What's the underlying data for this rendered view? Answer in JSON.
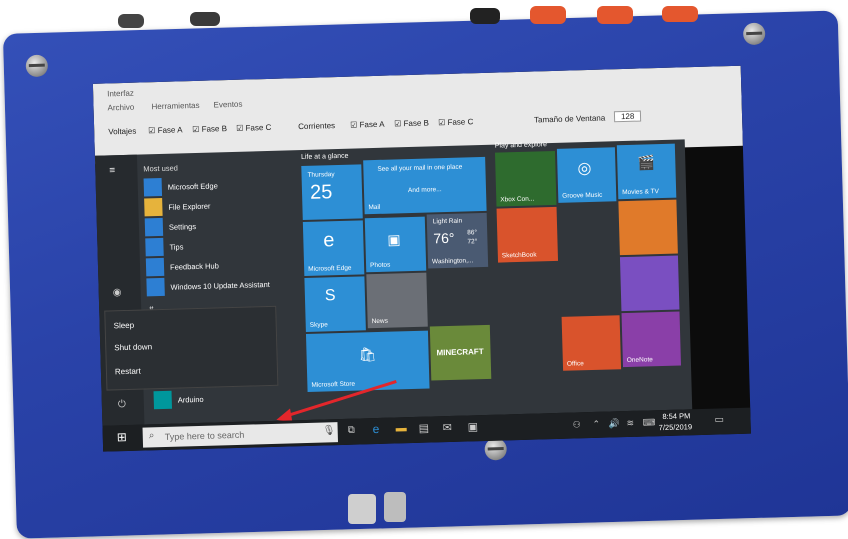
{
  "app": {
    "title": "Interfaz",
    "menus": [
      "Archivo",
      "Herramientas",
      "Eventos"
    ],
    "voltajes_label": "Voltajes",
    "corrientes_label": "Corrientes",
    "phases": [
      "Fase A",
      "Fase B",
      "Fase C"
    ],
    "window_size_label": "Tamaño de Ventana",
    "window_size_value": "128"
  },
  "start_menu": {
    "most_used_label": "Most used",
    "most_used": [
      "Microsoft Edge",
      "File Explorer",
      "Settings",
      "Tips",
      "Feedback Hub",
      "Windows 10 Update Assistant"
    ],
    "section_hash": "#",
    "power_options": [
      "Sleep",
      "Shut down",
      "Restart"
    ],
    "arduino_label": "Arduino"
  },
  "tiles": {
    "life_header": "Life at a glance",
    "play_header": "Play and explore",
    "calendar_day": "Thursday",
    "calendar_date": "25",
    "mail_text": "See all your mail in one place",
    "mail_more": "And more...",
    "mail_label": "Mail",
    "edge_label": "Microsoft Edge",
    "photos_label": "Photos",
    "weather_cond": "Light Rain",
    "weather_temp": "76°",
    "weather_hi": "86°",
    "weather_lo": "72°",
    "weather_city": "Washington,...",
    "skype_label": "Skype",
    "news_label": "News",
    "store_label": "Microsoft Store",
    "minecraft_label": "MINECRAFT",
    "xbox_label": "Xbox Con...",
    "groove_label": "Groove Music",
    "movies_label": "Movies & TV",
    "sketchbook_label": "SketchBook",
    "office_label": "Office",
    "onenote_label": "OneNote"
  },
  "taskbar": {
    "search_placeholder": "Type here to search",
    "time": "8:54 PM",
    "date": "7/25/2019"
  },
  "colors": {
    "case_blue": "#2a43a9",
    "tile_blue": "#2d8fd5",
    "arrow_red": "#e3262b"
  }
}
